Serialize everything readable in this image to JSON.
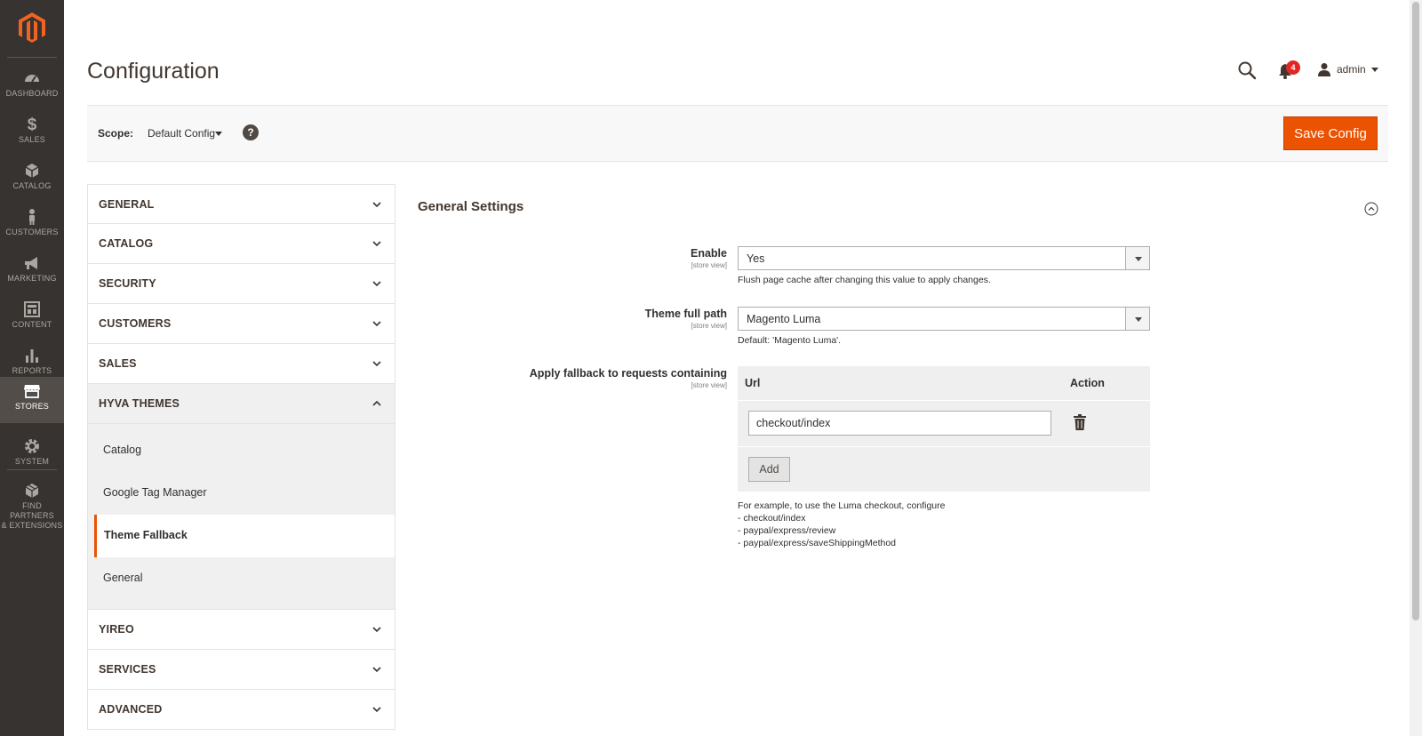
{
  "nav": {
    "items": [
      {
        "label": "DASHBOARD",
        "icon": "dashboard-icon"
      },
      {
        "label": "SALES",
        "icon": "dollar-icon"
      },
      {
        "label": "CATALOG",
        "icon": "cube-icon"
      },
      {
        "label": "CUSTOMERS",
        "icon": "person-icon"
      },
      {
        "label": "MARKETING",
        "icon": "megaphone-icon"
      },
      {
        "label": "CONTENT",
        "icon": "layout-icon"
      },
      {
        "label": "REPORTS",
        "icon": "bar-chart-icon"
      },
      {
        "label": "STORES",
        "icon": "store-icon",
        "active": true
      },
      {
        "label": "SYSTEM",
        "icon": "gear-icon"
      },
      {
        "label_line1": "FIND PARTNERS",
        "label_line2": "& EXTENSIONS",
        "icon": "boxes-icon"
      }
    ]
  },
  "header": {
    "title": "Configuration",
    "notifications": "4",
    "user": "admin"
  },
  "scope": {
    "label": "Scope:",
    "value": "Default Config",
    "help": "?",
    "save_label": "Save Config"
  },
  "tabs": {
    "general": "GENERAL",
    "catalog": "CATALOG",
    "security": "SECURITY",
    "customers": "CUSTOMERS",
    "sales": "SALES",
    "hyva": "HYVA THEMES",
    "hyva_items": [
      "Catalog",
      "Google Tag Manager",
      "Theme Fallback",
      "General"
    ],
    "yireo": "YIREO",
    "services": "SERVICES",
    "advanced": "ADVANCED"
  },
  "section": {
    "title": "General Settings",
    "enable": {
      "label": "Enable",
      "scope": "[store view]",
      "value": "Yes",
      "comment": "Flush page cache after changing this value to apply changes."
    },
    "theme": {
      "label": "Theme full path",
      "scope": "[store view]",
      "value": "Magento Luma",
      "comment": "Default: 'Magento Luma'."
    },
    "fallback": {
      "label": "Apply fallback to requests containing",
      "scope": "[store view]",
      "col_url": "Url",
      "col_action": "Action",
      "row_value": "checkout/index",
      "add_label": "Add",
      "example": [
        "For example, to use the Luma checkout, configure",
        "- checkout/index",
        "- paypal/express/review",
        "- paypal/express/saveShippingMethod"
      ]
    }
  },
  "colors": {
    "accent": "#eb5202",
    "nav_bg": "#373330",
    "badge": "#e22626"
  }
}
